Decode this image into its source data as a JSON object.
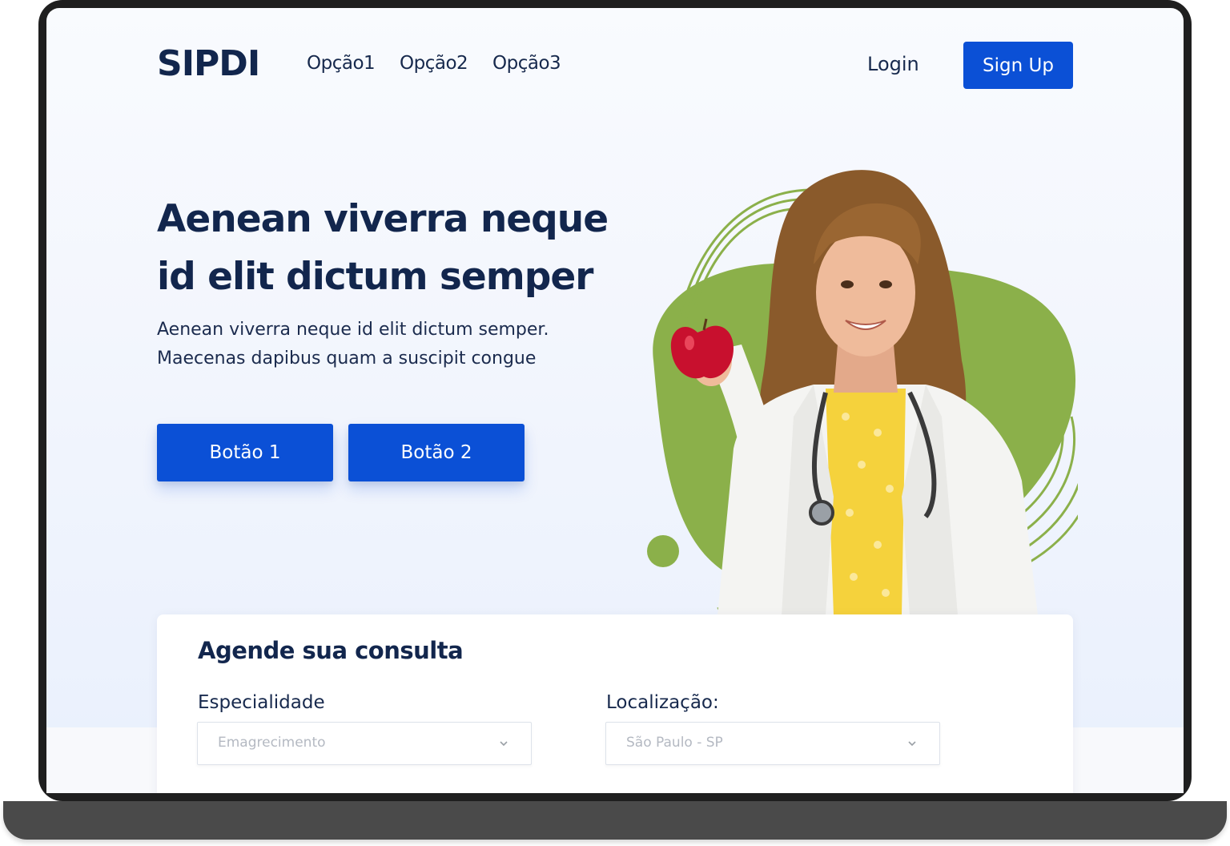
{
  "brand": {
    "logo": "SIPDI"
  },
  "nav": {
    "items": [
      "Opção1",
      "Opção2",
      "Opção3"
    ],
    "login": "Login",
    "signup": "Sign Up"
  },
  "hero": {
    "title": "Aenean viverra neque id elit dictum semper",
    "subtitle_line1": "Aenean viverra neque id elit dictum semper.",
    "subtitle_line2": "Maecenas dapibus quam a suscipit congue",
    "button1": "Botão 1",
    "button2": "Botão 2"
  },
  "booking": {
    "title": "Agende sua consulta",
    "specialty_label": "Especialidade",
    "specialty_value": "Emagrecimento",
    "location_label": "Localização:",
    "location_value": "São Paulo - SP"
  },
  "colors": {
    "primary": "#0b50d6",
    "navy": "#12264d",
    "accent_green": "#8bb04a",
    "apple_red": "#c8102e",
    "shirt_yellow": "#f5d23c"
  },
  "icons": [
    "chevron-down-icon",
    "stethoscope-icon",
    "apple-icon"
  ]
}
